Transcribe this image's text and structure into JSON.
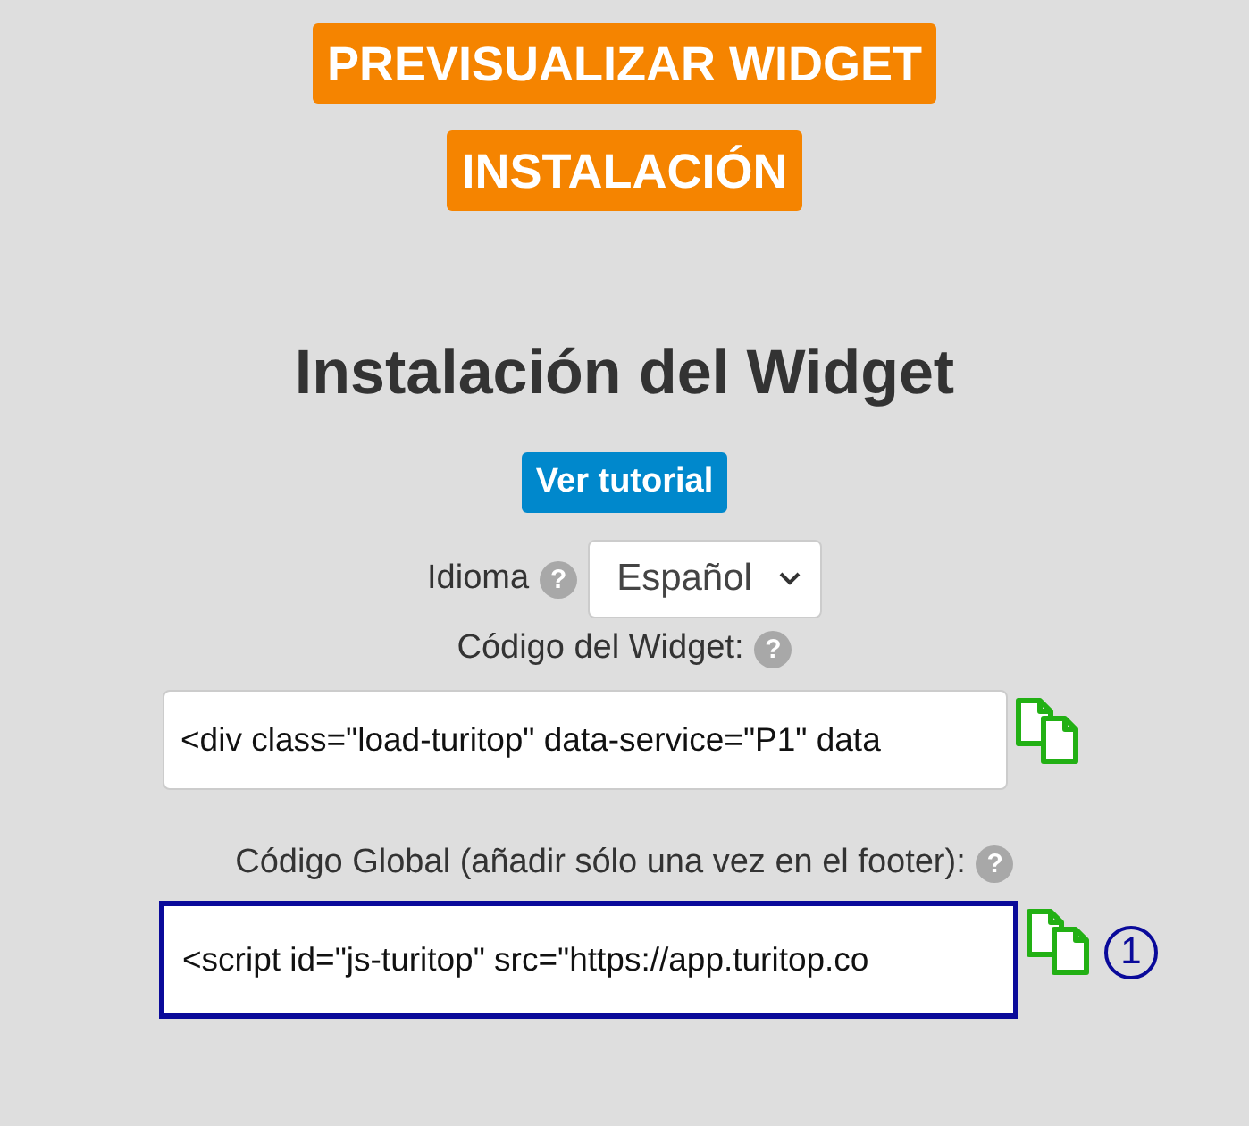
{
  "top_buttons": [
    {
      "label": "PREVISUALIZAR WIDGET"
    },
    {
      "label": "INSTALACIÓN"
    }
  ],
  "title": "Instalación del Widget",
  "tutorial_button": {
    "label": "Ver tutorial"
  },
  "language": {
    "label": "Idioma",
    "help": "?",
    "value": "Español"
  },
  "code_fields": [
    {
      "label": "Código del Widget:",
      "help": "?",
      "value": "<div class=\"load-turitop\" data-service=\"P1\" data",
      "highlighted": false
    },
    {
      "label": "Código Global (añadir sólo una vez en el footer):",
      "help": "?",
      "value": "<script id=\"js-turitop\" src=\"https://app.turitop.co",
      "highlighted": true,
      "marker": "1"
    }
  ]
}
